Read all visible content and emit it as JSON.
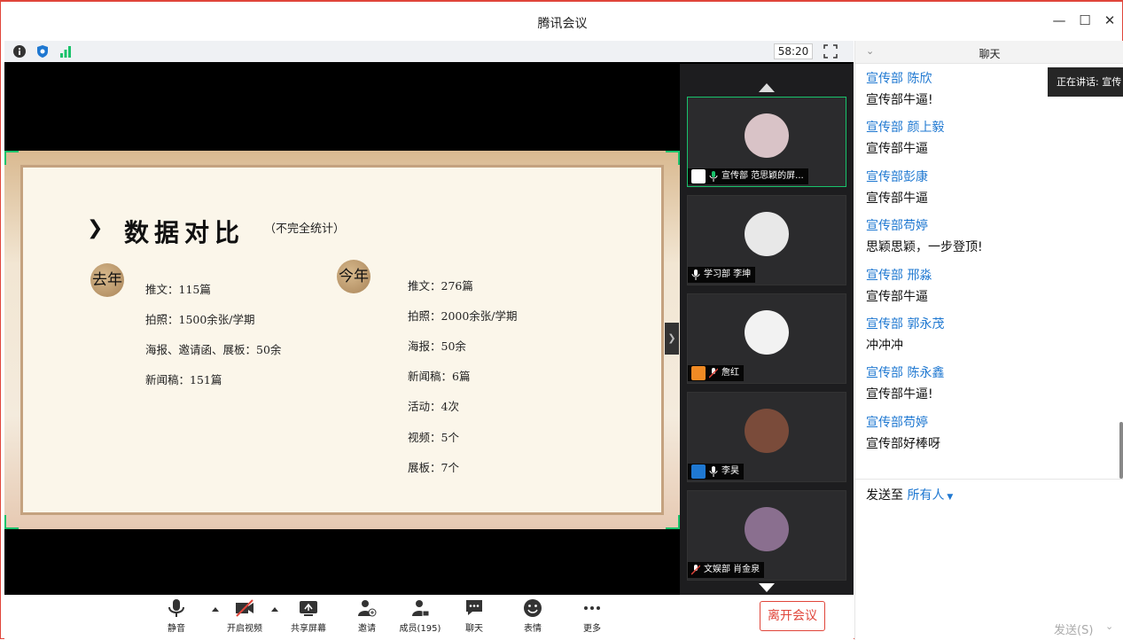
{
  "window": {
    "title": "腾讯会议",
    "controls": [
      "minimize-icon",
      "maximize-icon",
      "close-icon"
    ]
  },
  "meeting": {
    "timer": "58:20",
    "status_icons": [
      "info-icon",
      "shield-icon",
      "signal-icon"
    ]
  },
  "slide": {
    "title": "数据对比",
    "subtitle": "（不完全统计）",
    "last_year": {
      "label": "去年",
      "items": [
        "推文：115篇",
        "拍照：1500余张/学期",
        "海报、邀请函、展板：50余",
        "新闻稿：151篇"
      ]
    },
    "this_year": {
      "label": "今年",
      "items": [
        "推文：276篇",
        "拍照：2000余张/学期",
        "海报：50余",
        "新闻稿：6篇",
        "活动：4次",
        "视频：5个",
        "展板：7个"
      ]
    }
  },
  "participants": [
    {
      "label": "宣传部 范思颖的屏...",
      "active": true
    },
    {
      "label": "学习部 李坤",
      "active": false
    },
    {
      "label": "詹红",
      "active": false
    },
    {
      "label": "李昊",
      "active": false
    },
    {
      "label": "文娱部 肖金泉",
      "active": false
    }
  ],
  "chat": {
    "title": "聊天",
    "speaking": "正在讲话: 宣传",
    "messages": [
      {
        "name": "宣传部 陈欣",
        "text": "宣传部牛逼!"
      },
      {
        "name": "宣传部 颜上毅",
        "text": "宣传部牛逼"
      },
      {
        "name": "宣传部彭康",
        "text": "宣传部牛逼"
      },
      {
        "name": "宣传部苟婷",
        "text": "思颖思颖，一步登顶!"
      },
      {
        "name": "宣传部 邢淼",
        "text": "宣传部牛逼"
      },
      {
        "name": "宣传部 郭永茂",
        "text": "冲冲冲"
      },
      {
        "name": "宣传部 陈永鑫",
        "text": "宣传部牛逼!"
      },
      {
        "name": "宣传部苟婷",
        "text": "宣传部好棒呀"
      }
    ],
    "send_to_label": "发送至",
    "send_to_target": "所有人",
    "send_button": "发送(S)"
  },
  "toolbar": {
    "mute": "静音",
    "video": "开启视频",
    "share": "共享屏幕",
    "invite": "邀请",
    "members": "成员(195)",
    "chat": "聊天",
    "emoji": "表情",
    "more": "更多",
    "leave": "离开会议"
  },
  "colors": {
    "accent_blue": "#1f78d1",
    "leave_red": "#e0453a",
    "active_green": "#19c26b"
  }
}
